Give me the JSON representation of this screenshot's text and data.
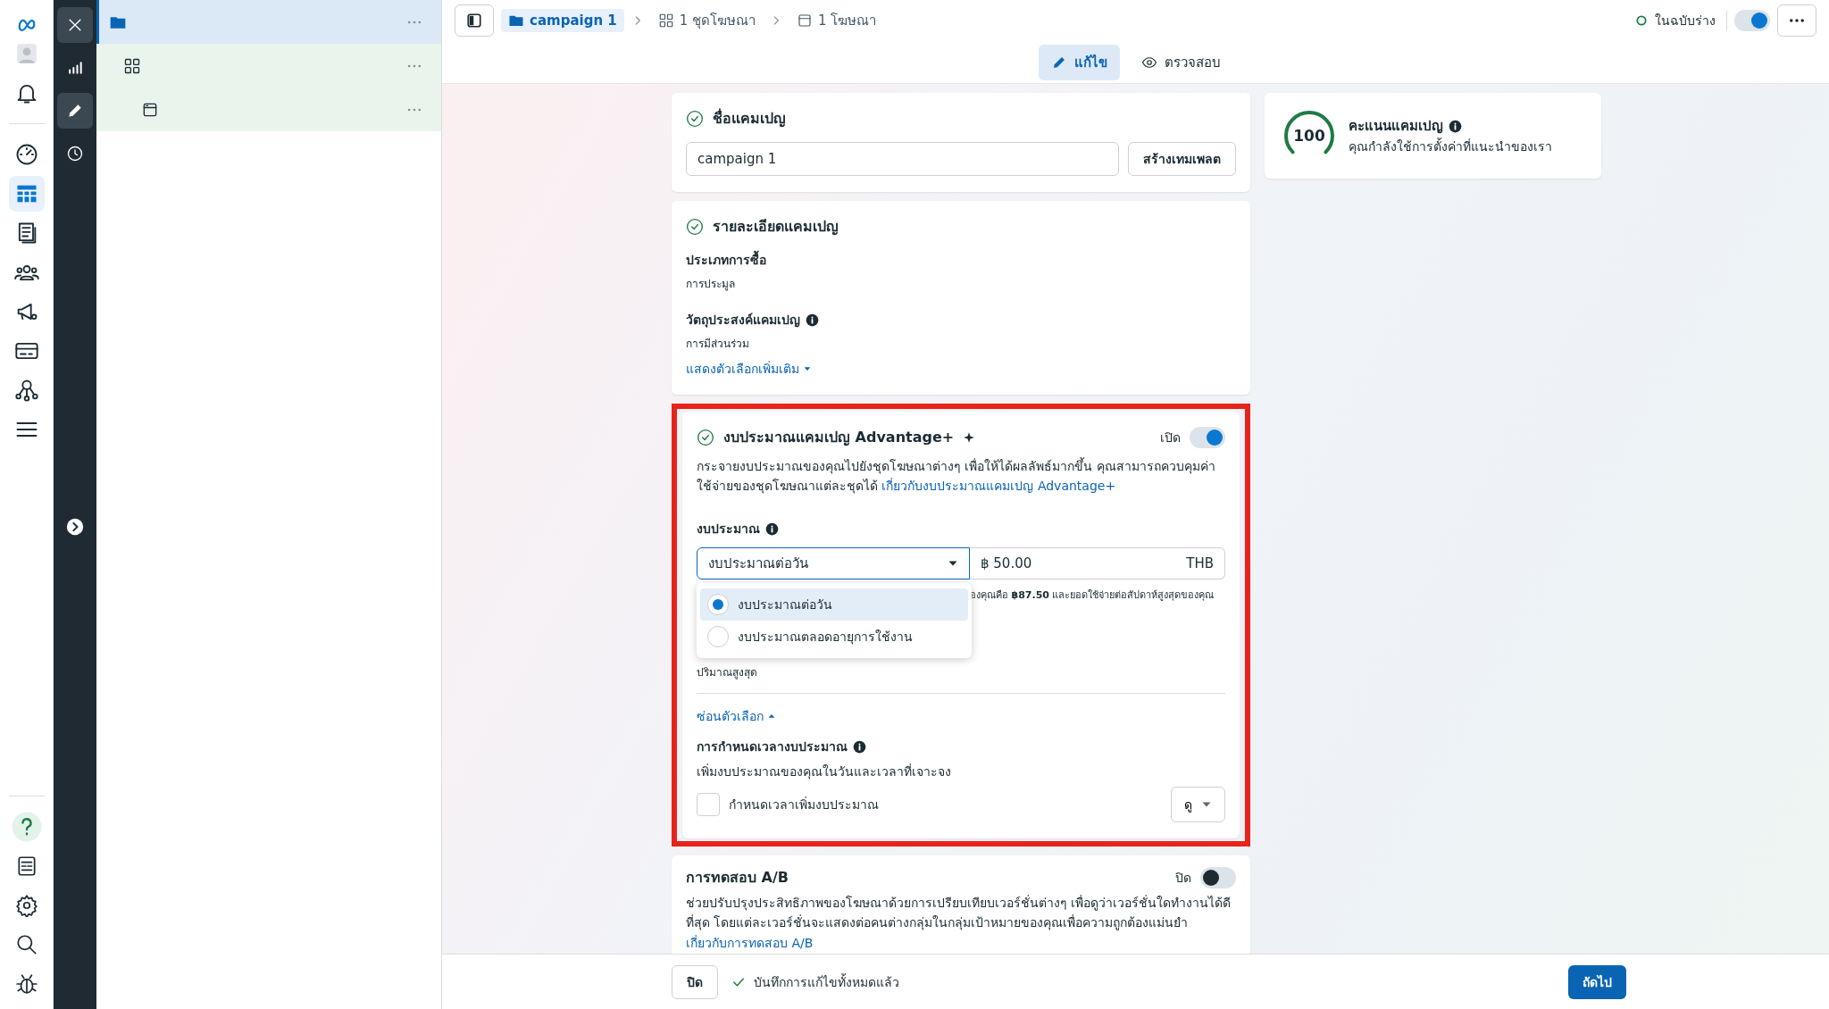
{
  "nav_rail": {
    "items": [
      {
        "selected": false
      },
      {
        "selected": false
      },
      {
        "selected": false
      },
      {
        "selected": true
      },
      {
        "selected": false
      },
      {
        "selected": false
      },
      {
        "selected": false
      },
      {
        "selected": false
      },
      {
        "selected": false
      },
      {
        "selected": false
      }
    ]
  },
  "tool_column": {
    "items": [
      {
        "selected": false
      },
      {
        "selected": true
      },
      {
        "selected": false
      }
    ]
  },
  "tree": {
    "rows": [
      {
        "selected": true
      },
      {
        "selected": false
      },
      {
        "selected": false
      }
    ]
  },
  "header": {
    "breadcrumbs": [
      {
        "label": "campaign 1",
        "selected": true
      },
      {
        "label": "1 ชุดโฆษณา",
        "selected": false
      },
      {
        "label": "1 โฆษณา",
        "selected": false
      }
    ],
    "status": "ในฉบับร่าง",
    "toggle_on": true,
    "mode_tabs": [
      {
        "label": "แก้ไข",
        "selected": true
      },
      {
        "label": "ตรวจสอบ",
        "selected": false
      }
    ]
  },
  "campaign_name": {
    "title": "ชื่อแคมเปญ",
    "value": "campaign 1",
    "button": "สร้างเทมเพลต"
  },
  "score": {
    "value": "100",
    "title": "คะแนนแคมเปญ",
    "subtitle": "คุณกำลังใช้การตั้งค่าที่แนะนำของเรา"
  },
  "details": {
    "title": "รายละเอียดแคมเปญ",
    "fields": [
      {
        "label": "ประเภทการซื้อ",
        "value": "การประมูล",
        "info": false
      },
      {
        "label": "วัตถุประสงค์แคมเปญ",
        "value": "การมีส่วนร่วม",
        "info": true
      }
    ],
    "link": "แสดงตัวเลือกเพิ่มเติม"
  },
  "budget": {
    "title": "งบประมาณแคมเปญ Advantage+",
    "toggle_label": "เปิด",
    "on": true,
    "description": "กระจายงบประมาณของคุณไปยังชุดโฆษณาต่างๆ เพื่อให้ได้ผลลัพธ์มากขึ้น คุณสามารถควบคุมค่าใช้จ่ายของชุดโฆษณาแต่ละชุดได้ ",
    "link": "เกี่ยวกับงบประมาณแคมเปญ Advantage+",
    "budget_label": "งบประมาณ",
    "select_value": "งบประมาณต่อวัน",
    "amount": "฿ 50.00",
    "currency": "THB",
    "note": "องคุณคือ **฿87.50** และยอดใช้จ่ายต่อสัปดาห์สูงสุดของคุณ",
    "options": [
      {
        "label": "งบประมาณต่อวัน",
        "selected": true
      },
      {
        "label": "งบประมาณตลอดอายุการใช้งาน",
        "selected": false
      }
    ],
    "cap_value": "ปริมาณสูงสุด",
    "hide_link": "ซ่อนตัวเลือก",
    "schedule_title": "การกำหนดเวลางบประมาณ",
    "schedule_desc": "เพิ่มงบประมาณของคุณในวันและเวลาที่เจาะจง",
    "checkbox_label": "กำหนดเวลาเพิ่มงบประมาณ",
    "checked": false,
    "view_button": "ดู"
  },
  "ab_test": {
    "title": "การทดสอบ A/B",
    "toggle_label": "ปิด",
    "on": false,
    "description": "ช่วยปรับปรุงประสิทธิภาพของโฆษณาด้วยการเปรียบเทียบเวอร์ชั่นต่างๆ เพื่อดูว่าเวอร์ชั่นใดทำงานได้ดีที่สุด โดยแต่ละเวอร์ชั่นจะแสดงต่อคนต่างกลุ่มในกลุ่มเป้าหมายของคุณเพื่อความถูกต้องแม่นยำ",
    "link": "เกี่ยวกับการทดสอบ A/B"
  },
  "footer": {
    "close": "ปิด",
    "saved": "บันทึกการแก้ไขทั้งหมดแล้ว",
    "next": "ถัดไป"
  }
}
